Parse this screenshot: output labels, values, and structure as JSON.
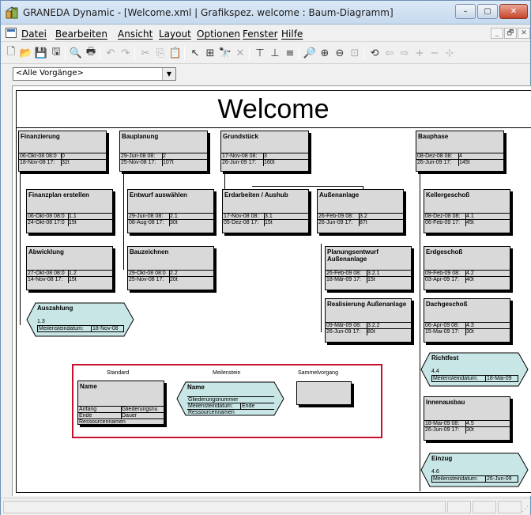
{
  "window": {
    "title": "GRANEDA Dynamic - [Welcome.xml | Grafikspez. welcome : Baum-Diagramm]",
    "min_label": "–",
    "max_label": "▢",
    "close_label": "✕"
  },
  "menu": {
    "items": [
      "Datei",
      "Bearbeiten",
      "Ansicht",
      "Layout",
      "Optionen",
      "Fenster",
      "Hilfe"
    ],
    "mdi_min": "_",
    "mdi_restore": "🗗",
    "mdi_close": "✕"
  },
  "toolbar": {
    "icons": [
      "new-icon",
      "open-icon",
      "save-icon",
      "save-all-icon",
      "print-preview-icon",
      "print-icon",
      "undo-icon",
      "redo-icon",
      "cut-icon",
      "copy-icon",
      "paste-icon",
      "pointer-icon",
      "insert-box-icon",
      "find-icon",
      "delete-icon",
      "tree-layout-icon",
      "hierarchy-icon",
      "align-icon",
      "zoom-fit-icon",
      "zoom-in-icon",
      "zoom-out-icon",
      "zoom-page-icon",
      "refresh-icon",
      "arrow-left-icon",
      "arrow-right-icon",
      "plus-icon",
      "minus-icon",
      "expand-icon"
    ],
    "glyphs": [
      "🗋",
      "📂",
      "💾",
      "🖫",
      "🔍",
      "🖶",
      "↶",
      "↷",
      "✂",
      "⎘",
      "📋",
      "↖",
      "⊞",
      "🔭",
      "✕",
      "⊤",
      "⊥",
      "≡",
      "🔎",
      "⊕",
      "⊖",
      "⊡",
      "⟲",
      "⇦",
      "⇨",
      "+",
      "−",
      "⊹"
    ]
  },
  "filter": {
    "selected": "<Alle Vorgänge>"
  },
  "diagram": {
    "title": "Welcome",
    "boxes": [
      {
        "id": "finanzierung",
        "name": "Finanzierung",
        "r1a": "06-Okt-08 08:0",
        "r1b": "0",
        "r2a": "18-Nov-08 17:",
        "r2b": "32t"
      },
      {
        "id": "bauplanung",
        "name": "Bauplanung",
        "r1a": "29-Jun-08 08:",
        "r1b": "2",
        "r2a": "25-Nov-08 17:",
        "r2b": "107t"
      },
      {
        "id": "grundstueck",
        "name": "Grundstück",
        "r1a": "17-Nov-08 08:",
        "r1b": "3",
        "r2a": "26-Jun-09 17:",
        "r2b": "160t"
      },
      {
        "id": "bauphase",
        "name": "Bauphase",
        "r1a": "08-Dez-08 08:",
        "r1b": "4",
        "r2a": "26-Jun-09 17:",
        "r2b": "145t"
      },
      {
        "id": "finanzplan",
        "name": "Finanzplan erstellen",
        "r1a": "06-Okt-08 08:0",
        "r1b": "1.1",
        "r2a": "24-Okt-08 17:0",
        "r2b": "15t"
      },
      {
        "id": "entwurf",
        "name": "Entwurf auswählen",
        "r1a": "29-Jun-08 08:",
        "r1b": "2.1",
        "r2a": "08-Aug-08 17:",
        "r2b": "30t"
      },
      {
        "id": "erdarbeiten",
        "name": "Erdarbeiten / Aushub",
        "r1a": "17-Nov-08 08:",
        "r1b": "3.1",
        "r2a": "05-Dez-08 17:",
        "r2b": "15t"
      },
      {
        "id": "aussenanlage",
        "name": "Außenanlage",
        "r1a": "26-Feb-09 08:",
        "r1b": "3.2",
        "r2a": "26-Jun-09 17:",
        "r2b": "87t"
      },
      {
        "id": "keller",
        "name": "Kellergeschoß",
        "r1a": "08-Dez-08 08:",
        "r1b": "4.1",
        "r2a": "06-Feb-09 17:",
        "r2b": "45t"
      },
      {
        "id": "abwicklung",
        "name": "Abwicklung",
        "r1a": "27-Okt-08 08:0",
        "r1b": "1.2",
        "r2a": "14-Nov-08 17:",
        "r2b": "15t"
      },
      {
        "id": "bauzeichnen",
        "name": "Bauzeichnen",
        "r1a": "29-Okt-08 08:0",
        "r1b": "2.2",
        "r2a": "25-Nov-08 17:",
        "r2b": "20t"
      },
      {
        "id": "planungsentwurf",
        "name": "Planungsentwurf",
        "name2": "Außenanlage",
        "r1a": "26-Feb-09 08:",
        "r1b": "3.2.1",
        "r2a": "18-Mär-09 17:",
        "r2b": "15t"
      },
      {
        "id": "erdgeschoss",
        "name": "Erdgeschoß",
        "r1a": "09-Feb-09 08:",
        "r1b": "4.2",
        "r2a": "03-Apr-09 17:",
        "r2b": "40t"
      },
      {
        "id": "realisierung",
        "name": "Realisierung Außenanlage",
        "r1a": "09-Mär-09 08:",
        "r1b": "3.2.2",
        "r2a": "26-Jun-09 17:",
        "r2b": "80t"
      },
      {
        "id": "dachgeschoss",
        "name": "Dachgeschoß",
        "r1a": "06-Apr-09 08:",
        "r1b": "4.3",
        "r2a": "15-Mai-09 17:",
        "r2b": "30t"
      },
      {
        "id": "innenausbau",
        "name": "Innenausbau",
        "r1a": "18-Mai-09 08:",
        "r1b": "4.5",
        "r2a": "26-Jun-09 17:",
        "r2b": "30t"
      }
    ],
    "milestones": [
      {
        "id": "auszahlung",
        "name": "Auszahlung",
        "code": "1.3",
        "label": "Meilensteindatum:",
        "date": "18-Nov-08"
      },
      {
        "id": "richtfest",
        "name": "Richtfest",
        "code": "4.4",
        "label": "Meilensteindatum:",
        "date": "18-Mai-09"
      },
      {
        "id": "einzug",
        "name": "Einzug",
        "code": "4.6",
        "label": "Meilensteindatum:",
        "date": "26-Jun-09"
      }
    ],
    "legend": {
      "standard_title": "Standard",
      "milestone_title": "Meilenstein",
      "summary_title": "Sammelvorgang",
      "standard_name": "Name",
      "standard_start": "Anfang",
      "standard_code": "Gliederungsnu",
      "standard_end": "Ende",
      "standard_duration": "Dauer",
      "standard_resources": "Ressourcennamen",
      "milestone_name": "Name",
      "milestone_code": "Gliederungsnummer",
      "milestone_date_label": "Meilensteindatum:",
      "milestone_end": "Ende",
      "milestone_resources": "Ressourcennamen"
    }
  },
  "colors": {
    "task_fill": "#d9d9d9",
    "milestone_fill": "#c8e6e6",
    "legend_border": "#c8102e"
  }
}
